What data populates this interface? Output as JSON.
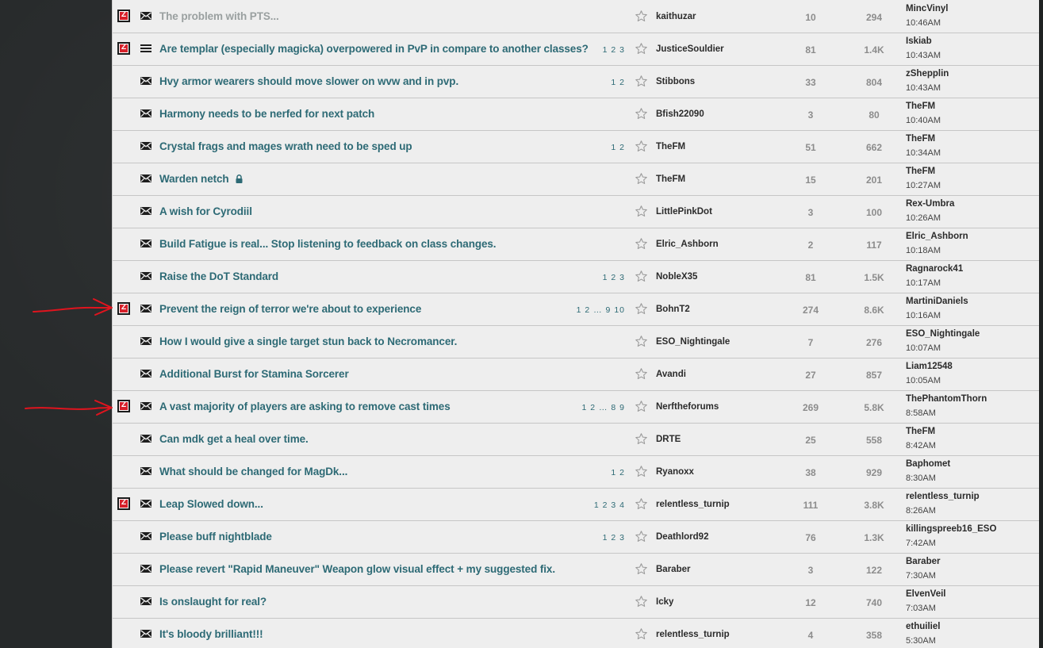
{
  "colors": {
    "link": "#2d6a75",
    "annotation_red": "#e0141e",
    "badge_red": "#d6202a",
    "row_bg": "#eeeeee"
  },
  "icons": {
    "row_type": "envelope-icon",
    "row_type_alt": "list-icon",
    "bookmark": "star-icon",
    "closed": "lock-icon",
    "badge": "zenimax-z-icon"
  },
  "threads": [
    {
      "badge": true,
      "icon": "envelope",
      "title": "The problem with PTS...",
      "pages": "",
      "locked": false,
      "author": "kaithuzar",
      "comments": "10",
      "views": "294",
      "last_user": "MincVinyl",
      "last_time": "10:46AM"
    },
    {
      "badge": true,
      "icon": "list",
      "title": "Are templar (especially magicka) overpowered in PvP in compare to another classes?",
      "pages": "1 2 3",
      "locked": false,
      "author": "JusticeSouldier",
      "comments": "81",
      "views": "1.4K",
      "last_user": "Iskiab",
      "last_time": "10:43AM"
    },
    {
      "badge": false,
      "icon": "envelope",
      "title": "Hvy armor wearers should move slower on wvw and in pvp.",
      "pages": "1 2",
      "locked": false,
      "author": "Stibbons",
      "comments": "33",
      "views": "804",
      "last_user": "zShepplin",
      "last_time": "10:43AM"
    },
    {
      "badge": false,
      "icon": "envelope",
      "title": "Harmony needs to be nerfed for next patch",
      "pages": "",
      "locked": false,
      "author": "Bfish22090",
      "comments": "3",
      "views": "80",
      "last_user": "TheFM",
      "last_time": "10:40AM"
    },
    {
      "badge": false,
      "icon": "envelope",
      "title": "Crystal frags and mages wrath need to be sped up",
      "pages": "1 2",
      "locked": false,
      "author": "TheFM",
      "comments": "51",
      "views": "662",
      "last_user": "TheFM",
      "last_time": "10:34AM"
    },
    {
      "badge": false,
      "icon": "envelope",
      "title": "Warden netch",
      "pages": "",
      "locked": true,
      "author": "TheFM",
      "comments": "15",
      "views": "201",
      "last_user": "TheFM",
      "last_time": "10:27AM"
    },
    {
      "badge": false,
      "icon": "envelope",
      "title": "A wish for Cyrodiil",
      "pages": "",
      "locked": false,
      "author": "LittlePinkDot",
      "comments": "3",
      "views": "100",
      "last_user": "Rex-Umbra",
      "last_time": "10:26AM"
    },
    {
      "badge": false,
      "icon": "envelope",
      "title": "Build Fatigue is real... Stop listening to feedback on class changes.",
      "pages": "",
      "locked": false,
      "author": "Elric_Ashborn",
      "comments": "2",
      "views": "117",
      "last_user": "Elric_Ashborn",
      "last_time": "10:18AM"
    },
    {
      "badge": false,
      "icon": "envelope",
      "title": "Raise the DoT Standard",
      "pages": "1 2 3",
      "locked": false,
      "author": "NobleX35",
      "comments": "81",
      "views": "1.5K",
      "last_user": "Ragnarock41",
      "last_time": "10:17AM"
    },
    {
      "badge": true,
      "icon": "envelope",
      "title": "Prevent the reign of terror we're about to experience",
      "pages": "1 2 … 9 10",
      "locked": false,
      "author": "BohnT2",
      "comments": "274",
      "views": "8.6K",
      "last_user": "MartiniDaniels",
      "last_time": "10:16AM"
    },
    {
      "badge": false,
      "icon": "envelope",
      "title": "How I would give a single target stun back to Necromancer.",
      "pages": "",
      "locked": false,
      "author": "ESO_Nightingale",
      "comments": "7",
      "views": "276",
      "last_user": "ESO_Nightingale",
      "last_time": "10:07AM"
    },
    {
      "badge": false,
      "icon": "envelope",
      "title": "Additional Burst for Stamina Sorcerer",
      "pages": "",
      "locked": false,
      "author": "Avandi",
      "comments": "27",
      "views": "857",
      "last_user": "Liam12548",
      "last_time": "10:05AM"
    },
    {
      "badge": true,
      "icon": "envelope",
      "title": "A vast majority of players are asking to remove cast times",
      "pages": "1 2 … 8 9",
      "locked": false,
      "author": "Nerftheforums",
      "comments": "269",
      "views": "5.8K",
      "last_user": "ThePhantomThorn",
      "last_time": "8:58AM"
    },
    {
      "badge": false,
      "icon": "envelope",
      "title": "Can mdk get a heal over time.",
      "pages": "",
      "locked": false,
      "author": "DRTE",
      "comments": "25",
      "views": "558",
      "last_user": "TheFM",
      "last_time": "8:42AM"
    },
    {
      "badge": false,
      "icon": "envelope",
      "title": "What should be changed for MagDk...",
      "pages": "1 2",
      "locked": false,
      "author": "Ryanoxx",
      "comments": "38",
      "views": "929",
      "last_user": "Baphomet",
      "last_time": "8:30AM"
    },
    {
      "badge": true,
      "icon": "envelope",
      "title": "Leap Slowed down...",
      "pages": "1 2 3 4",
      "locked": false,
      "author": "relentless_turnip",
      "comments": "111",
      "views": "3.8K",
      "last_user": "relentless_turnip",
      "last_time": "8:26AM"
    },
    {
      "badge": false,
      "icon": "envelope",
      "title": "Please buff nightblade",
      "pages": "1 2 3",
      "locked": false,
      "author": "Deathlord92",
      "comments": "76",
      "views": "1.3K",
      "last_user": "killingspreeb16_ESO",
      "last_time": "7:42AM"
    },
    {
      "badge": false,
      "icon": "envelope",
      "title": "Please revert \"Rapid Maneuver\" Weapon glow visual effect + my suggested fix.",
      "pages": "",
      "locked": false,
      "author": "Baraber",
      "comments": "3",
      "views": "122",
      "last_user": "Baraber",
      "last_time": "7:30AM"
    },
    {
      "badge": false,
      "icon": "envelope",
      "title": "Is onslaught for real?",
      "pages": "",
      "locked": false,
      "author": "Icky",
      "comments": "12",
      "views": "740",
      "last_user": "ElvenVeil",
      "last_time": "7:03AM"
    },
    {
      "badge": false,
      "icon": "envelope",
      "title": "It's bloody brilliant!!!",
      "pages": "",
      "locked": false,
      "author": "relentless_turnip",
      "comments": "4",
      "views": "358",
      "last_user": "ethuiliel",
      "last_time": "5:30AM"
    }
  ]
}
